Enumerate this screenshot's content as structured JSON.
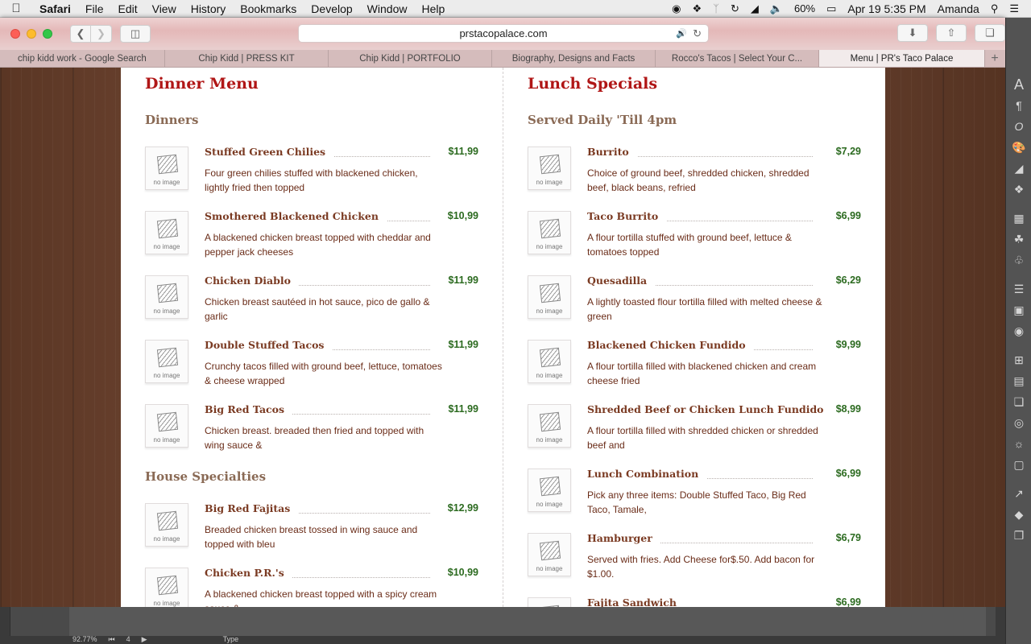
{
  "menubar": {
    "apple": "",
    "app": "Safari",
    "items": [
      "File",
      "Edit",
      "View",
      "History",
      "Bookmarks",
      "Develop",
      "Window",
      "Help"
    ],
    "battery": "60%",
    "datetime": "Apr 19  5:35 PM",
    "user": "Amanda"
  },
  "browser": {
    "url": "prstacopalace.com",
    "tabs": [
      "chip kidd work - Google Search",
      "Chip Kidd | PRESS KIT",
      "Chip Kidd | PORTFOLIO",
      "Biography, Designs and Facts",
      "Rocco's Tacos | Select Your C...",
      "Menu | PR's Taco Palace"
    ],
    "new_tab": "+"
  },
  "left": {
    "title": "Dinner Menu",
    "sections": [
      {
        "title": "Dinners",
        "items": [
          {
            "name": "Stuffed Green Chilies",
            "price": "$11,99",
            "desc": "Four green chilies stuffed with blackened chicken, lightly fried then topped"
          },
          {
            "name": "Smothered Blackened Chicken",
            "price": "$10,99",
            "desc": "A blackened chicken breast topped with cheddar and pepper jack cheeses"
          },
          {
            "name": "Chicken Diablo",
            "price": "$11,99",
            "desc": "Chicken breast sautéed in hot sauce, pico de gallo & garlic"
          },
          {
            "name": "Double Stuffed Tacos",
            "price": "$11,99",
            "desc": "Crunchy tacos filled with ground beef, lettuce, tomatoes & cheese wrapped"
          },
          {
            "name": "Big Red Tacos",
            "price": "$11,99",
            "desc": "Chicken breast. breaded then fried and topped with wing sauce &"
          }
        ]
      },
      {
        "title": "House Specialties",
        "items": [
          {
            "name": "Big Red Fajitas",
            "price": "$12,99",
            "desc": "Breaded chicken breast tossed in wing sauce and topped with bleu"
          },
          {
            "name": "Chicken P.R.'s",
            "price": "$10,99",
            "desc": "A blackened chicken breast topped with a spicy cream sauce &"
          }
        ]
      }
    ]
  },
  "right": {
    "title": "Lunch Specials",
    "sections": [
      {
        "title": "Served Daily 'Till 4pm",
        "items": [
          {
            "name": "Burrito",
            "price": "$7,29",
            "desc": "Choice of ground beef, shredded chicken, shredded beef, black beans, refried"
          },
          {
            "name": "Taco Burrito",
            "price": "$6,99",
            "desc": "A flour tortilla stuffed with ground beef, lettuce & tomatoes topped"
          },
          {
            "name": "Quesadilla",
            "price": "$6,29",
            "desc": "A lightly toasted flour tortilla filled with melted cheese & green"
          },
          {
            "name": "Blackened Chicken Fundido",
            "price": "$9,99",
            "desc": "A flour tortilla filled with blackened chicken and cream cheese fried"
          },
          {
            "name": "Shredded Beef or Chicken Lunch Fundido",
            "price": "$8,99",
            "desc": "A flour tortilla filled with shredded chicken or shredded beef and"
          },
          {
            "name": "Lunch Combination",
            "price": "$6,99",
            "desc": "Pick any three items: Double Stuffed Taco, Big Red Taco, Tamale,"
          },
          {
            "name": "Hamburger",
            "price": "$6,79",
            "desc": "Served with fries. Add Cheese for$.50. Add bacon for $1.00."
          },
          {
            "name": "Fajita Sandwich",
            "price": "$6,99",
            "desc": ""
          }
        ]
      }
    ]
  },
  "no_image_label": "no image",
  "background_app": {
    "zoom": "92.77%",
    "page": "4",
    "type_label": "Type"
  },
  "colors": {
    "title_red": "#b01616",
    "price_green": "#2b6a1f",
    "item_brown": "#7a3a22",
    "section_tan": "#8a6a55"
  }
}
